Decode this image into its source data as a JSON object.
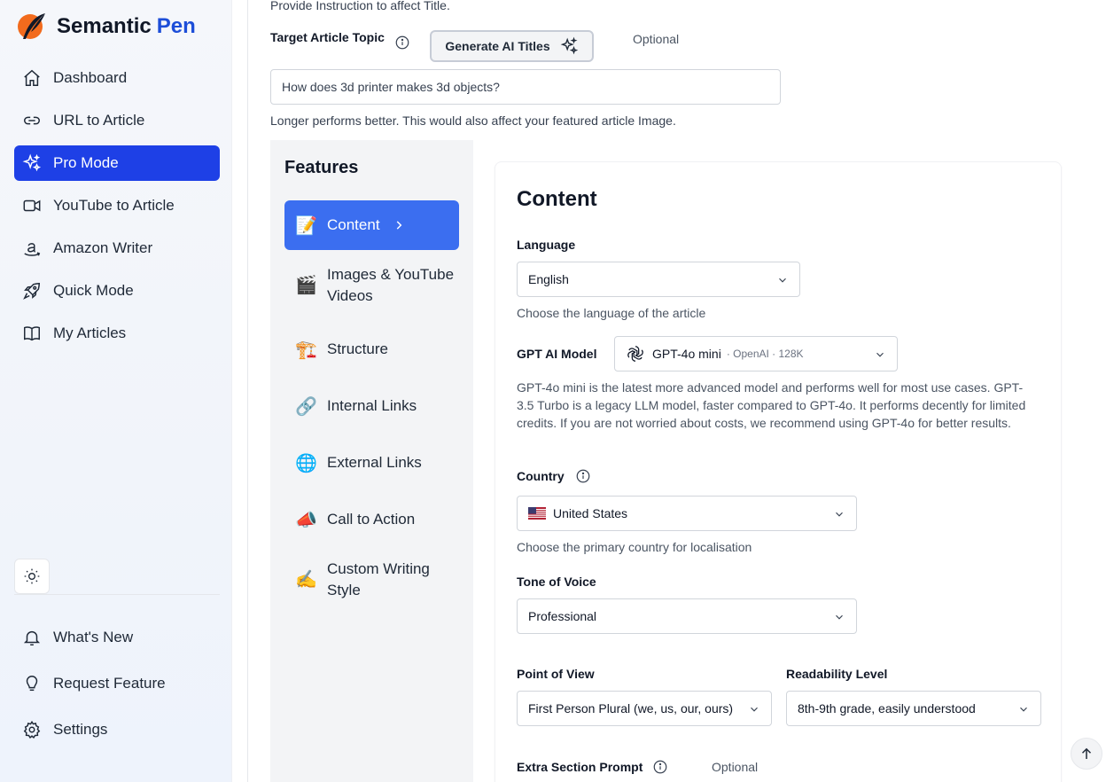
{
  "brand": {
    "name": "Semantic",
    "accent": "Pen"
  },
  "sidebar": {
    "items": [
      {
        "label": "Dashboard",
        "icon": "home-icon"
      },
      {
        "label": "URL to Article",
        "icon": "link-icon"
      },
      {
        "label": "Pro Mode",
        "icon": "sparkles-icon",
        "active": true
      },
      {
        "label": "YouTube to Article",
        "icon": "video-icon"
      },
      {
        "label": "Amazon Writer",
        "icon": "amazon-icon"
      },
      {
        "label": "Quick Mode",
        "icon": "rocket-icon"
      },
      {
        "label": "My Articles",
        "icon": "book-icon"
      }
    ],
    "bottom": [
      {
        "label": "What's New",
        "icon": "bell-icon"
      },
      {
        "label": "Request Feature",
        "icon": "lightbulb-icon"
      },
      {
        "label": "Settings",
        "icon": "gear-icon"
      }
    ]
  },
  "form": {
    "hint_top": "Provide Instruction to affect Title.",
    "topic_label": "Target Article Topic",
    "generate_button": "Generate AI Titles",
    "optional_label": "Optional",
    "topic_value": "How does 3d printer makes 3d objects?",
    "topic_help": "Longer performs better. This would also affect your featured article Image."
  },
  "features": {
    "title": "Features",
    "items": [
      {
        "emoji": "📝",
        "label": "Content",
        "active": true
      },
      {
        "emoji": "🎬",
        "label": "Images & YouTube Videos"
      },
      {
        "emoji": "🏗️",
        "label": "Structure"
      },
      {
        "emoji": "🔗",
        "label": "Internal Links"
      },
      {
        "emoji": "🌐",
        "label": "External Links"
      },
      {
        "emoji": "📣",
        "label": "Call to Action"
      },
      {
        "emoji": "✍️",
        "label": "Custom Writing Style"
      }
    ]
  },
  "content": {
    "title": "Content",
    "language_label": "Language",
    "language_value": "English",
    "language_help": "Choose the language of the article",
    "model_label": "GPT AI Model",
    "model_value": "GPT-4o mini",
    "model_meta": "· OpenAI · 128K",
    "model_help": "GPT-4o mini is the latest more advanced model and performs well for most use cases. GPT-3.5 Turbo is a legacy LLM model, faster compared to GPT-4o. It performs decently for limited credits. If you are not worried about costs, we recommend using GPT-4o for better results.",
    "country_label": "Country",
    "country_value": "United States",
    "country_help": "Choose the primary country for localisation",
    "tone_label": "Tone of Voice",
    "tone_value": "Professional",
    "pov_label": "Point of View",
    "pov_value": "First Person Plural (we, us, our, ours)",
    "readability_label": "Readability Level",
    "readability_value": "8th-9th grade, easily understood",
    "extra_label": "Extra Section Prompt",
    "extra_optional": "Optional"
  },
  "colors": {
    "accent": "#1e40e6",
    "feature_active": "#3b6ef0",
    "brand_orange": "#f26b1d"
  }
}
